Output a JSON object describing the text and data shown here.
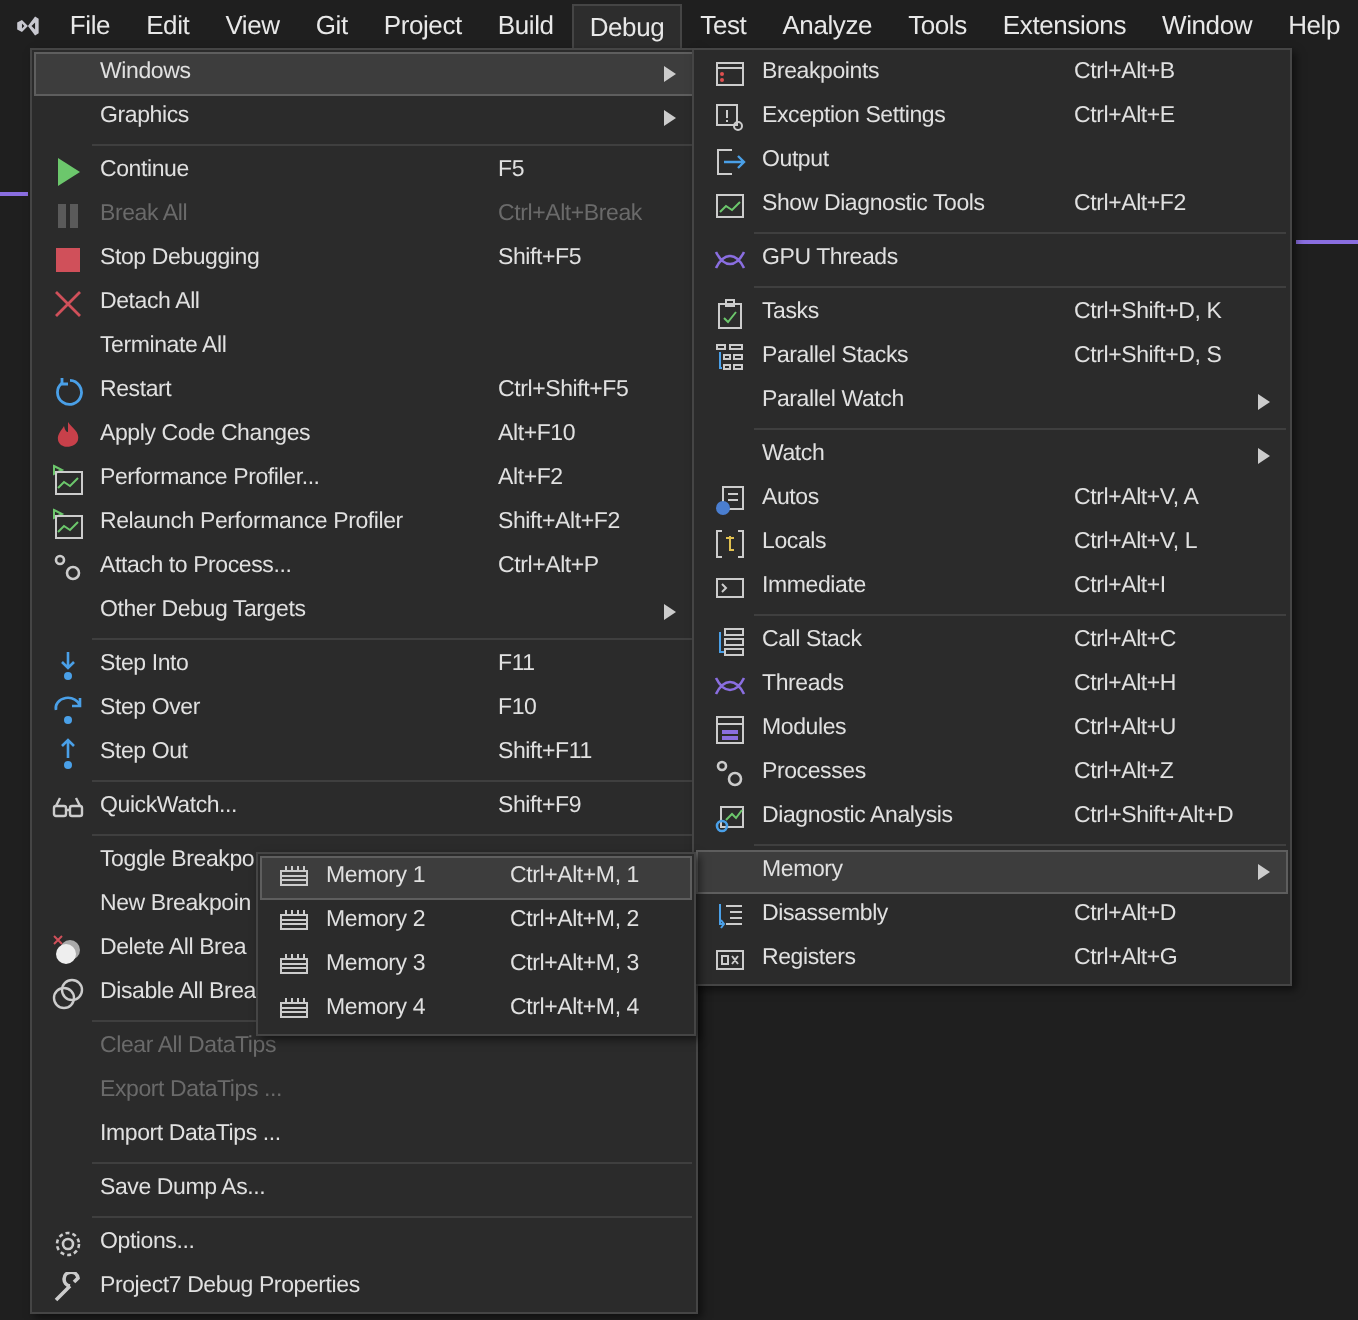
{
  "menu_bar": {
    "items": [
      {
        "label": "File",
        "selected": false
      },
      {
        "label": "Edit",
        "selected": false
      },
      {
        "label": "View",
        "selected": false
      },
      {
        "label": "Git",
        "selected": false
      },
      {
        "label": "Project",
        "selected": false
      },
      {
        "label": "Build",
        "selected": false
      },
      {
        "label": "Debug",
        "selected": true
      },
      {
        "label": "Test",
        "selected": false
      },
      {
        "label": "Analyze",
        "selected": false
      },
      {
        "label": "Tools",
        "selected": false
      },
      {
        "label": "Extensions",
        "selected": false
      },
      {
        "label": "Window",
        "selected": false
      },
      {
        "label": "Help",
        "selected": false
      }
    ]
  },
  "debug_menu": {
    "groups": [
      [
        {
          "label": "Windows",
          "submenu": true,
          "disabled": false,
          "selected": true
        },
        {
          "label": "Graphics",
          "submenu": true,
          "disabled": false,
          "selected": false
        }
      ],
      [
        {
          "label": "Continue",
          "shortcut": "F5",
          "submenu": false,
          "disabled": false,
          "selected": false
        },
        {
          "label": "Break All",
          "shortcut": "Ctrl+Alt+Break",
          "submenu": false,
          "disabled": true,
          "selected": false
        },
        {
          "label": "Stop Debugging",
          "shortcut": "Shift+F5",
          "submenu": false,
          "disabled": false,
          "selected": false
        },
        {
          "label": "Detach All",
          "submenu": false,
          "disabled": false,
          "selected": false
        },
        {
          "label": "Terminate All",
          "submenu": false,
          "disabled": false,
          "selected": false
        },
        {
          "label": "Restart",
          "shortcut": "Ctrl+Shift+F5",
          "submenu": false,
          "disabled": false,
          "selected": false
        },
        {
          "label": "Apply Code Changes",
          "shortcut": "Alt+F10",
          "submenu": false,
          "disabled": false,
          "selected": false
        },
        {
          "label": "Performance Profiler...",
          "shortcut": "Alt+F2",
          "submenu": false,
          "disabled": false,
          "selected": false
        },
        {
          "label": "Relaunch Performance Profiler",
          "shortcut": "Shift+Alt+F2",
          "submenu": false,
          "disabled": false,
          "selected": false
        },
        {
          "label": "Attach to Process...",
          "shortcut": "Ctrl+Alt+P",
          "submenu": false,
          "disabled": false,
          "selected": false
        },
        {
          "label": "Other Debug Targets",
          "submenu": true,
          "disabled": false,
          "selected": false
        }
      ],
      [
        {
          "label": "Step Into",
          "shortcut": "F11",
          "submenu": false,
          "disabled": false,
          "selected": false
        },
        {
          "label": "Step Over",
          "shortcut": "F10",
          "submenu": false,
          "disabled": false,
          "selected": false
        },
        {
          "label": "Step Out",
          "shortcut": "Shift+F11",
          "submenu": false,
          "disabled": false,
          "selected": false
        }
      ],
      [
        {
          "label": "QuickWatch...",
          "shortcut": "Shift+F9",
          "submenu": false,
          "disabled": false,
          "selected": false
        }
      ],
      [
        {
          "label": "Toggle Breakpo",
          "submenu": false,
          "disabled": false,
          "selected": false
        },
        {
          "label": "New Breakpoin",
          "submenu": false,
          "disabled": false,
          "selected": false
        },
        {
          "label": "Delete All Brea",
          "submenu": false,
          "disabled": false,
          "selected": false
        },
        {
          "label": "Disable All Brea",
          "submenu": false,
          "disabled": false,
          "selected": false
        }
      ],
      [
        {
          "label": "Clear All DataTips",
          "submenu": false,
          "disabled": true,
          "selected": false
        },
        {
          "label": "Export DataTips ...",
          "submenu": false,
          "disabled": true,
          "selected": false
        },
        {
          "label": "Import DataTips ...",
          "submenu": false,
          "disabled": false,
          "selected": false
        }
      ],
      [
        {
          "label": "Save Dump As...",
          "submenu": false,
          "disabled": false,
          "selected": false
        }
      ],
      [
        {
          "label": "Options...",
          "submenu": false,
          "disabled": false,
          "selected": false
        },
        {
          "label": "Project7 Debug Properties",
          "submenu": false,
          "disabled": false,
          "selected": false
        }
      ]
    ]
  },
  "windows_submenu": {
    "groups": [
      [
        {
          "label": "Breakpoints",
          "shortcut": "Ctrl+Alt+B",
          "submenu": false,
          "selected": false
        },
        {
          "label": "Exception Settings",
          "shortcut": "Ctrl+Alt+E",
          "submenu": false,
          "selected": false
        },
        {
          "label": "Output",
          "submenu": false,
          "selected": false
        },
        {
          "label": "Show Diagnostic Tools",
          "shortcut": "Ctrl+Alt+F2",
          "submenu": false,
          "selected": false
        }
      ],
      [
        {
          "label": "GPU Threads",
          "submenu": false,
          "selected": false
        }
      ],
      [
        {
          "label": "Tasks",
          "shortcut": "Ctrl+Shift+D, K",
          "submenu": false,
          "selected": false
        },
        {
          "label": "Parallel Stacks",
          "shortcut": "Ctrl+Shift+D, S",
          "submenu": false,
          "selected": false
        },
        {
          "label": "Parallel Watch",
          "submenu": true,
          "selected": false
        }
      ],
      [
        {
          "label": "Watch",
          "submenu": true,
          "selected": false
        },
        {
          "label": "Autos",
          "shortcut": "Ctrl+Alt+V, A",
          "submenu": false,
          "selected": false
        },
        {
          "label": "Locals",
          "shortcut": "Ctrl+Alt+V, L",
          "submenu": false,
          "selected": false
        },
        {
          "label": "Immediate",
          "shortcut": "Ctrl+Alt+I",
          "submenu": false,
          "selected": false
        }
      ],
      [
        {
          "label": "Call Stack",
          "shortcut": "Ctrl+Alt+C",
          "submenu": false,
          "selected": false
        },
        {
          "label": "Threads",
          "shortcut": "Ctrl+Alt+H",
          "submenu": false,
          "selected": false
        },
        {
          "label": "Modules",
          "shortcut": "Ctrl+Alt+U",
          "submenu": false,
          "selected": false
        },
        {
          "label": "Processes",
          "shortcut": "Ctrl+Alt+Z",
          "submenu": false,
          "selected": false
        },
        {
          "label": "Diagnostic Analysis",
          "shortcut": "Ctrl+Shift+Alt+D",
          "submenu": false,
          "selected": false
        }
      ],
      [
        {
          "label": "Memory",
          "submenu": true,
          "selected": true
        },
        {
          "label": "Disassembly",
          "shortcut": "Ctrl+Alt+D",
          "submenu": false,
          "selected": false
        },
        {
          "label": "Registers",
          "shortcut": "Ctrl+Alt+G",
          "submenu": false,
          "selected": false
        }
      ]
    ]
  },
  "memory_submenu": {
    "groups": [
      [
        {
          "label": "Memory 1",
          "shortcut": "Ctrl+Alt+M, 1",
          "submenu": false,
          "selected": true
        },
        {
          "label": "Memory 2",
          "shortcut": "Ctrl+Alt+M, 2",
          "submenu": false,
          "selected": false
        },
        {
          "label": "Memory 3",
          "shortcut": "Ctrl+Alt+M, 3",
          "submenu": false,
          "selected": false
        },
        {
          "label": "Memory 4",
          "shortcut": "Ctrl+Alt+M, 4",
          "submenu": false,
          "selected": false
        }
      ]
    ]
  }
}
